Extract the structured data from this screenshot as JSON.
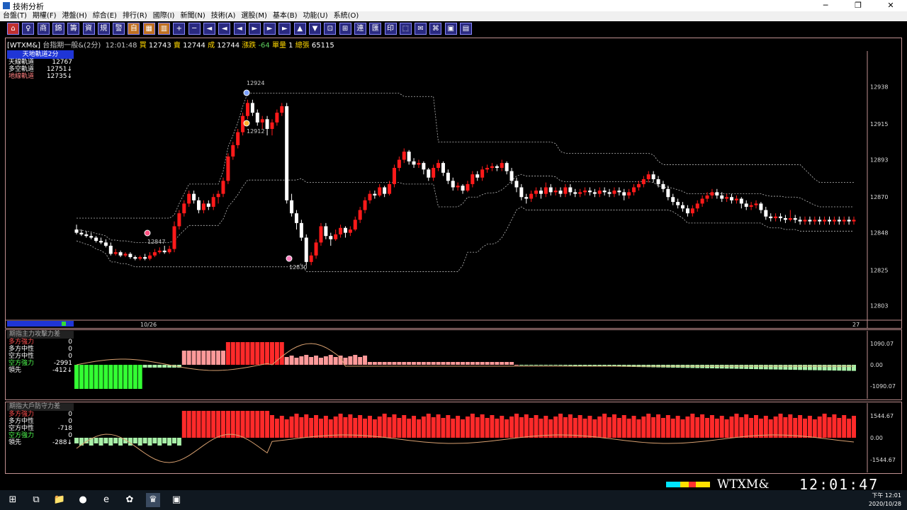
{
  "window": {
    "title": "技術分析",
    "min": "─",
    "max": "❐",
    "close": "✕"
  },
  "menu": [
    "台盤(T)",
    "期權(F)",
    "港盤(H)",
    "綜合(E)",
    "排行(R)",
    "國際(I)",
    "新聞(N)",
    "技術(A)",
    "選股(M)",
    "基本(B)",
    "功能(U)",
    "系統(O)"
  ],
  "toolbar_icons": [
    "home",
    "chart",
    "list",
    "table",
    "grid",
    "bars",
    "select",
    "note",
    "monitor",
    "auto",
    "calc",
    "cols",
    "plus",
    "minus",
    "back",
    "back2",
    "left",
    "right",
    "fwd2",
    "fwd",
    "up",
    "down",
    "zoom",
    "merge",
    "link",
    "box",
    "print",
    "grid2",
    "chat",
    "save",
    "num"
  ],
  "toolbar_glyphs": [
    "⌂",
    "♀",
    "商",
    "錦",
    "籌",
    "資",
    "規",
    "警",
    "自",
    "▦",
    "▥",
    "+",
    "─",
    "◄",
    "◄",
    "◄",
    "►",
    "►",
    "►",
    "▲",
    "▼",
    "⊡",
    "⊞",
    "連",
    "匯",
    "印",
    "⬚",
    "✉",
    "⌘",
    "▣",
    "▤"
  ],
  "quote": {
    "symbol": "[WTXM&]",
    "name": "台指期一般&(2分)",
    "time": "12:01:48",
    "buy_label": "買",
    "buy": "12743",
    "sell_label": "賣",
    "sell": "12744",
    "deal_label": "成",
    "deal": "12744",
    "change_label": "漲跌",
    "change": "-64",
    "unit_label": "單量",
    "unit": "1",
    "total_label": "總張",
    "total": "65115"
  },
  "legend": {
    "title": "天地軌道2分",
    "rows": [
      {
        "label": "天線軌道",
        "value": "12767",
        "color": "#ffffff"
      },
      {
        "label": "多空軌道",
        "value": "12751↓",
        "color": "#ffffff"
      },
      {
        "label": "地線軌道",
        "value": "12735↓",
        "color": "#ff8080"
      }
    ]
  },
  "main_chart": {
    "y_ticks": [
      "12938",
      "12915",
      "12893",
      "12870",
      "12848",
      "12825",
      "12803"
    ],
    "date_labels": [
      "10/26",
      "27"
    ],
    "annotations": [
      "12924",
      "12912",
      "12847",
      "12830"
    ],
    "candles": [
      [
        12850,
        12848,
        12853,
        12847
      ],
      [
        12848,
        12847,
        12850,
        12846
      ],
      [
        12847,
        12846,
        12849,
        12845
      ],
      [
        12846,
        12845,
        12848,
        12844
      ],
      [
        12845,
        12843,
        12846,
        12842
      ],
      [
        12843,
        12842,
        12845,
        12841
      ],
      [
        12842,
        12840,
        12844,
        12839
      ],
      [
        12840,
        12835,
        12842,
        12834
      ],
      [
        12835,
        12836,
        12838,
        12834
      ],
      [
        12836,
        12834,
        12837,
        12833
      ],
      [
        12834,
        12835,
        12836,
        12833
      ],
      [
        12835,
        12833,
        12836,
        12832
      ],
      [
        12833,
        12832,
        12834,
        12831
      ],
      [
        12832,
        12833,
        12834,
        12831
      ],
      [
        12833,
        12832,
        12835,
        12831
      ],
      [
        12832,
        12834,
        12836,
        12831
      ],
      [
        12834,
        12836,
        12838,
        12833
      ],
      [
        12836,
        12837,
        12839,
        12835
      ],
      [
        12837,
        12836,
        12840,
        12835
      ],
      [
        12836,
        12838,
        12840,
        12835
      ],
      [
        12838,
        12852,
        12855,
        12836
      ],
      [
        12852,
        12860,
        12862,
        12850
      ],
      [
        12860,
        12866,
        12868,
        12858
      ],
      [
        12866,
        12872,
        12874,
        12864
      ],
      [
        12872,
        12868,
        12874,
        12866
      ],
      [
        12868,
        12862,
        12870,
        12860
      ],
      [
        12862,
        12866,
        12868,
        12860
      ],
      [
        12866,
        12864,
        12868,
        12862
      ],
      [
        12864,
        12870,
        12872,
        12862
      ],
      [
        12870,
        12872,
        12874,
        12866
      ],
      [
        12872,
        12880,
        12882,
        12870
      ],
      [
        12880,
        12895,
        12897,
        12878
      ],
      [
        12895,
        12902,
        12904,
        12893
      ],
      [
        12902,
        12910,
        12912,
        12900
      ],
      [
        12910,
        12920,
        12922,
        12908
      ],
      [
        12920,
        12928,
        12930,
        12918
      ],
      [
        12928,
        12922,
        12930,
        12920
      ],
      [
        12922,
        12916,
        12924,
        12914
      ],
      [
        12916,
        12918,
        12920,
        12912
      ],
      [
        12918,
        12912,
        12920,
        12908
      ],
      [
        12912,
        12916,
        12918,
        12908
      ],
      [
        12916,
        12922,
        12924,
        12914
      ],
      [
        12922,
        12926,
        12928,
        12920
      ],
      [
        12926,
        12868,
        12928,
        12866
      ],
      [
        12868,
        12860,
        12872,
        12858
      ],
      [
        12860,
        12854,
        12862,
        12850
      ],
      [
        12854,
        12845,
        12856,
        12843
      ],
      [
        12845,
        12830,
        12847,
        12828
      ],
      [
        12830,
        12834,
        12836,
        12828
      ],
      [
        12834,
        12842,
        12844,
        12832
      ],
      [
        12842,
        12852,
        12854,
        12840
      ],
      [
        12852,
        12846,
        12854,
        12844
      ],
      [
        12846,
        12844,
        12848,
        12840
      ],
      [
        12844,
        12847,
        12850,
        12843
      ],
      [
        12847,
        12851,
        12853,
        12845
      ],
      [
        12851,
        12848,
        12852,
        12845
      ],
      [
        12848,
        12850,
        12852,
        12846
      ],
      [
        12850,
        12856,
        12858,
        12849
      ],
      [
        12856,
        12862,
        12864,
        12854
      ],
      [
        12862,
        12868,
        12870,
        12860
      ],
      [
        12868,
        12872,
        12874,
        12866
      ],
      [
        12872,
        12871,
        12874,
        12869
      ],
      [
        12871,
        12876,
        12878,
        12870
      ],
      [
        12876,
        12872,
        12877,
        12870
      ],
      [
        12872,
        12878,
        12880,
        12871
      ],
      [
        12878,
        12888,
        12890,
        12876
      ],
      [
        12888,
        12893,
        12895,
        12886
      ],
      [
        12893,
        12898,
        12900,
        12891
      ],
      [
        12898,
        12892,
        12899,
        12890
      ],
      [
        12892,
        12890,
        12894,
        12888
      ],
      [
        12890,
        12891,
        12893,
        12888
      ],
      [
        12891,
        12887,
        12892,
        12884
      ],
      [
        12887,
        12882,
        12888,
        12880
      ],
      [
        12882,
        12888,
        12890,
        12880
      ],
      [
        12888,
        12891,
        12893,
        12886
      ],
      [
        12891,
        12885,
        12892,
        12883
      ],
      [
        12885,
        12880,
        12887,
        12878
      ],
      [
        12880,
        12876,
        12882,
        12874
      ],
      [
        12876,
        12877,
        12879,
        12874
      ],
      [
        12877,
        12874,
        12878,
        12872
      ],
      [
        12874,
        12878,
        12880,
        12873
      ],
      [
        12878,
        12884,
        12886,
        12876
      ],
      [
        12884,
        12882,
        12886,
        12880
      ],
      [
        12882,
        12887,
        12889,
        12880
      ],
      [
        12887,
        12888,
        12890,
        12885
      ],
      [
        12888,
        12889,
        12891,
        12886
      ],
      [
        12889,
        12888,
        12890,
        12886
      ],
      [
        12888,
        12891,
        12893,
        12886
      ],
      [
        12891,
        12886,
        12892,
        12884
      ],
      [
        12886,
        12880,
        12888,
        12878
      ],
      [
        12880,
        12876,
        12882,
        12873
      ],
      [
        12876,
        12870,
        12878,
        12868
      ],
      [
        12870,
        12869,
        12872,
        12866
      ],
      [
        12869,
        12872,
        12874,
        12867
      ],
      [
        12872,
        12874,
        12876,
        12870
      ],
      [
        12874,
        12872,
        12876,
        12869
      ],
      [
        12872,
        12876,
        12879,
        12870
      ],
      [
        12876,
        12873,
        12878,
        12871
      ],
      [
        12873,
        12874,
        12876,
        12871
      ],
      [
        12874,
        12872,
        12876,
        12870
      ],
      [
        12872,
        12876,
        12878,
        12870
      ],
      [
        12876,
        12873,
        12878,
        12871
      ],
      [
        12873,
        12872,
        12875,
        12870
      ],
      [
        12872,
        12873,
        12875,
        12870
      ],
      [
        12873,
        12874,
        12876,
        12871
      ],
      [
        12874,
        12873,
        12876,
        12871
      ],
      [
        12873,
        12872,
        12875,
        12870
      ],
      [
        12872,
        12874,
        12876,
        12870
      ],
      [
        12874,
        12873,
        12876,
        12871
      ],
      [
        12873,
        12872,
        12875,
        12870
      ],
      [
        12872,
        12874,
        12876,
        12870
      ],
      [
        12874,
        12873,
        12876,
        12871
      ],
      [
        12873,
        12871,
        12875,
        12868
      ],
      [
        12871,
        12873,
        12875,
        12869
      ],
      [
        12873,
        12876,
        12878,
        12871
      ],
      [
        12876,
        12878,
        12880,
        12874
      ],
      [
        12878,
        12881,
        12883,
        12876
      ],
      [
        12881,
        12884,
        12886,
        12879
      ],
      [
        12884,
        12881,
        12886,
        12879
      ],
      [
        12881,
        12878,
        12883,
        12876
      ],
      [
        12878,
        12875,
        12880,
        12873
      ],
      [
        12875,
        12870,
        12877,
        12868
      ],
      [
        12870,
        12867,
        12872,
        12865
      ],
      [
        12867,
        12865,
        12869,
        12863
      ],
      [
        12865,
        12863,
        12867,
        12861
      ],
      [
        12863,
        12860,
        12865,
        12858
      ],
      [
        12860,
        12863,
        12865,
        12858
      ],
      [
        12863,
        12866,
        12868,
        12861
      ],
      [
        12866,
        12869,
        12871,
        12864
      ],
      [
        12869,
        12871,
        12873,
        12867
      ],
      [
        12871,
        12873,
        12875,
        12869
      ],
      [
        12873,
        12871,
        12875,
        12869
      ],
      [
        12871,
        12869,
        12873,
        12867
      ],
      [
        12869,
        12870,
        12872,
        12867
      ],
      [
        12870,
        12868,
        12872,
        12866
      ],
      [
        12868,
        12869,
        12871,
        12866
      ],
      [
        12869,
        12866,
        12870,
        12863
      ],
      [
        12866,
        12864,
        12868,
        12862
      ],
      [
        12864,
        12865,
        12867,
        12862
      ],
      [
        12865,
        12866,
        12868,
        12863
      ],
      [
        12866,
        12862,
        12867,
        12860
      ],
      [
        12862,
        12858,
        12864,
        12856
      ],
      [
        12858,
        12857,
        12860,
        12855
      ],
      [
        12857,
        12858,
        12860,
        12855
      ],
      [
        12858,
        12857,
        12860,
        12855
      ],
      [
        12857,
        12856,
        12859,
        12854
      ],
      [
        12856,
        12857,
        12862,
        12855
      ],
      [
        12857,
        12856,
        12859,
        12854
      ],
      [
        12856,
        12855,
        12858,
        12853
      ],
      [
        12855,
        12856,
        12858,
        12853
      ],
      [
        12856,
        12855,
        12858,
        12853
      ],
      [
        12855,
        12856,
        12858,
        12853
      ],
      [
        12856,
        12855,
        12858,
        12853
      ],
      [
        12855,
        12856,
        12858,
        12853
      ],
      [
        12856,
        12855,
        12858,
        12853
      ],
      [
        12855,
        12856,
        12858,
        12853
      ],
      [
        12856,
        12855,
        12858,
        12853
      ],
      [
        12855,
        12856,
        12858,
        12853
      ],
      [
        12856,
        12855,
        12858,
        12853
      ],
      [
        12855,
        12856,
        12858,
        12853
      ]
    ]
  },
  "ind1": {
    "title": "期指主力攻擊力差",
    "rows": [
      {
        "label": "多方強力",
        "value": "0",
        "color": "#ff5050"
      },
      {
        "label": "多方中性",
        "value": "0",
        "color": "#ffffff"
      },
      {
        "label": "空方中性",
        "value": "0",
        "color": "#ffffff"
      },
      {
        "label": "空方強力",
        "value": "-2991",
        "color": "#50ff50"
      },
      {
        "label": "領先",
        "value": "-412↓",
        "color": "#ffffff"
      }
    ],
    "y_ticks": [
      "1090.07",
      "0.00",
      "-1090.07"
    ]
  },
  "ind2": {
    "title": "期指大戶防守力差",
    "rows": [
      {
        "label": "多方強力",
        "value": "0",
        "color": "#ff5050"
      },
      {
        "label": "多方中性",
        "value": "0",
        "color": "#ffffff"
      },
      {
        "label": "空方中性",
        "value": "-718",
        "color": "#ffffff"
      },
      {
        "label": "空方強力",
        "value": "0",
        "color": "#50ff50"
      },
      {
        "label": "領先",
        "value": "-288↓",
        "color": "#ffffff"
      }
    ],
    "y_ticks": [
      "1544.67",
      "0.00",
      "-1544.67"
    ]
  },
  "status": {
    "ticker": "WTXM&",
    "clock": "12:01:47"
  },
  "taskbar": {
    "time": "下午 12:01",
    "date": "2020/10/28",
    "icons": [
      "⊞",
      "⧉",
      "📁",
      "●",
      "e",
      "✿",
      "♛",
      "▣"
    ]
  },
  "colors": {
    "up": "#ff1a1a",
    "down": "#ffffff",
    "bull": "#ff2a2a",
    "bull_light": "#ff9a9a",
    "bear": "#33ff33",
    "bear_light": "#a8f0a8",
    "line": "#d8a070",
    "border": "#c09090"
  }
}
